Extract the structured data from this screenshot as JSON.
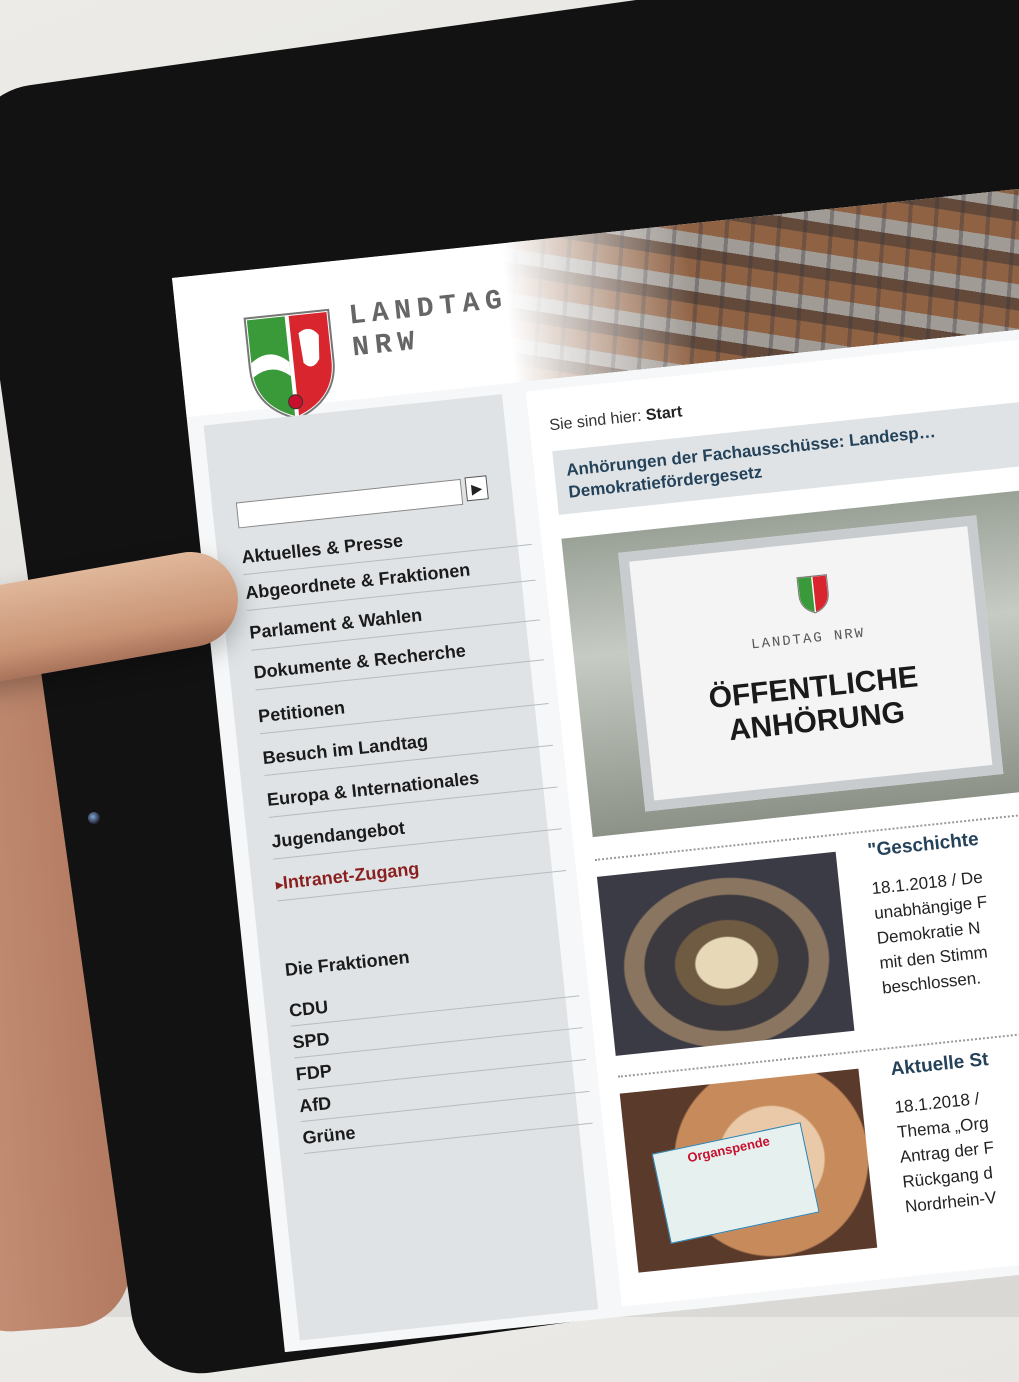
{
  "header": {
    "logo_text": "LANDTAG\nNRW"
  },
  "search": {
    "placeholder": "",
    "button_label": "▶"
  },
  "nav": {
    "items": [
      {
        "label": "Aktuelles & Presse"
      },
      {
        "label": "Abgeordnete & Fraktionen"
      },
      {
        "label": "Parlament & Wahlen"
      },
      {
        "label": "Dokumente & Recherche"
      },
      {
        "label": "Petitionen"
      },
      {
        "label": "Besuch im Landtag"
      },
      {
        "label": "Europa & Internationales"
      },
      {
        "label": "Jugendangebot"
      },
      {
        "label": "Intranet-Zugang"
      }
    ]
  },
  "fraktionen": {
    "title": "Die Fraktionen",
    "items": [
      {
        "label": "CDU"
      },
      {
        "label": "SPD"
      },
      {
        "label": "FDP"
      },
      {
        "label": "AfD"
      },
      {
        "label": "Grüne"
      }
    ]
  },
  "breadcrumb": {
    "prefix": "Sie sind hier:",
    "current": "Start"
  },
  "headline": "Anhörungen der Fachausschüsse: Landesp… Demokratiefördergesetz",
  "sign": {
    "logo_text": "LANDTAG NRW",
    "text": "ÖFFENTLICHE ANHÖRUNG"
  },
  "teasers": [
    {
      "title": "\"Geschichte",
      "text": "18.1.2018 /  De\nunabhängige F\nDemokratie N\nmit den Stimm\nbeschlossen."
    },
    {
      "title": "Aktuelle St",
      "text": "18.1.2018 /\nThema „Org\nAntrag der F\nRückgang d\nNordrhein-V"
    }
  ],
  "organ_card": {
    "text": "Organspende"
  },
  "colors": {
    "accent": "#24425a",
    "intranet": "#8a1f1f",
    "sidebar": "#dfe3e5"
  }
}
